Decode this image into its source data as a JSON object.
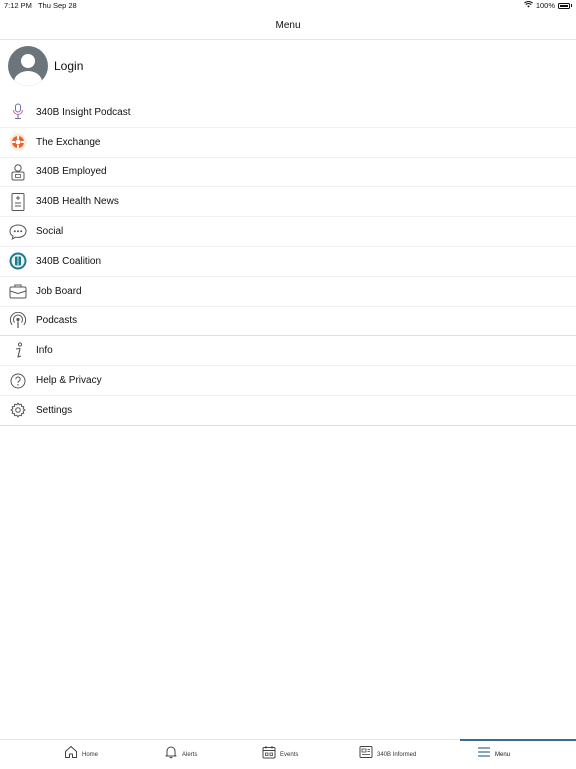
{
  "status_bar": {
    "time": "7:12 PM",
    "date": "Thu Sep 28",
    "battery": "100%"
  },
  "header": {
    "title": "Menu"
  },
  "login": {
    "label": "Login"
  },
  "menu": {
    "items": [
      {
        "label": "340B Insight Podcast",
        "icon": "microphone-icon"
      },
      {
        "label": "The Exchange",
        "icon": "exchange-logo-icon"
      },
      {
        "label": "340B Employed",
        "icon": "employee-badge-icon"
      },
      {
        "label": "340B Health News",
        "icon": "document-icon"
      },
      {
        "label": "Social",
        "icon": "chat-bubble-icon"
      },
      {
        "label": "340B Coalition",
        "icon": "coalition-logo-icon"
      },
      {
        "label": "Job Board",
        "icon": "briefcase-icon"
      },
      {
        "label": "Podcasts",
        "icon": "podcast-icon"
      },
      {
        "label": "Info",
        "icon": "info-icon"
      },
      {
        "label": "Help & Privacy",
        "icon": "help-icon"
      },
      {
        "label": "Settings",
        "icon": "gear-icon"
      }
    ]
  },
  "tabs": [
    {
      "label": "Home",
      "icon": "home-icon"
    },
    {
      "label": "Alerts",
      "icon": "bell-icon"
    },
    {
      "label": "Events",
      "icon": "calendar-icon"
    },
    {
      "label": "340B Informed",
      "icon": "newspaper-icon"
    },
    {
      "label": "Menu",
      "icon": "menu-icon"
    }
  ],
  "colors": {
    "accent": "#3a6b8c",
    "avatar": "#6c757c",
    "exchange_orange": "#e8622c",
    "coalition_teal": "#1d7a8c"
  }
}
